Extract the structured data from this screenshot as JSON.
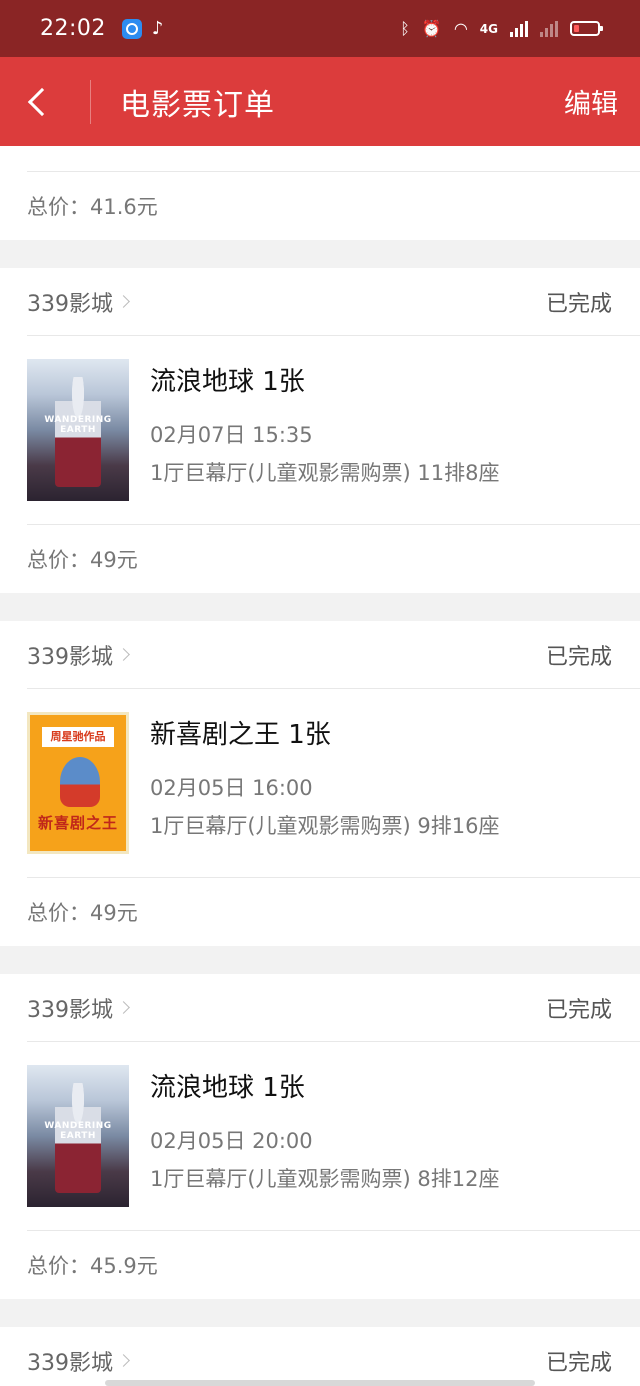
{
  "status_bar": {
    "time": "22:02",
    "network": "4G",
    "icons": [
      "browser-app-icon",
      "tiktok-icon",
      "bluetooth-icon",
      "alarm-icon",
      "wifi-icon",
      "signal-icon",
      "signal-x-icon",
      "battery-low-icon"
    ]
  },
  "nav": {
    "title": "电影票订单",
    "edit_label": "编辑",
    "back_icon": "chevron-left-icon"
  },
  "first_card_partial": {
    "total_label": "总价：41.6元"
  },
  "orders": [
    {
      "cinema": "339影城",
      "status": "已完成",
      "title": "流浪地球 1张",
      "time": "02月07日 15:35",
      "seat": "1厅巨幕厅(儿童观影需购票) 11排8座",
      "total": "总价：49元",
      "poster_text": "WANDERING EARTH"
    },
    {
      "cinema": "339影城",
      "status": "已完成",
      "title": "新喜剧之王 1张",
      "time": "02月05日 16:00",
      "seat": "1厅巨幕厅(儿童观影需购票) 9排16座",
      "total": "总价：49元",
      "poster_banner": "周星驰作品",
      "poster_text": "新喜剧之王"
    },
    {
      "cinema": "339影城",
      "status": "已完成",
      "title": "流浪地球 1张",
      "time": "02月05日 20:00",
      "seat": "1厅巨幕厅(儿童观影需购票) 8排12座",
      "total": "总价：45.9元",
      "poster_text": "WANDERING EARTH"
    }
  ],
  "last_card_partial": {
    "cinema": "339影城",
    "status": "已完成"
  }
}
